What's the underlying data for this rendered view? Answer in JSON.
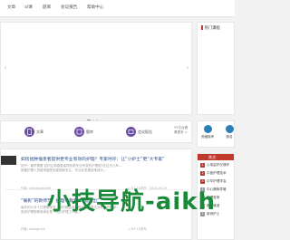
{
  "nav": {
    "items": [
      "文章",
      "al课",
      "题库",
      "会议报告",
      "帮助中心"
    ]
  },
  "side_card": {
    "title": "热门课程"
  },
  "quick_links": {
    "items": [
      {
        "label": "文章",
        "icon": "document-icon"
      },
      {
        "label": "题库",
        "icon": "question-icon"
      },
      {
        "label": "会议报告",
        "icon": "meeting-icon"
      }
    ],
    "more_label": "YY平台看\n看更多 >"
  },
  "side2": {
    "items": [
      {
        "label": "资格报考",
        "icon": "register-icon"
      },
      {
        "label": "报名",
        "icon": "signup-icon"
      }
    ]
  },
  "articles": [
    {
      "title": "如何给肿瘤患者提供更专业有效的护理？专家呼吁：让“小护士”更“大专家”",
      "summary_line1": "知乎：最早需要 如何让肿瘤患者得到更专业有效的护理呢?在过去几年...",
      "summary_line2": "肿瘤护理人员越来越受到重视和关注，专业化发展逐渐成为...",
      "author": "作者: chinadoctor66",
      "date": "◷ 07-14发布 · 2024-09-14"
    },
    {
      "title": "“联彰”的教师节：护理带教老师“圆满出”",
      "summary_line1": "每年的九月十日是教师节，我们都会用各种方式来表达对老师的感谢...",
      "summary_line2": "临床护理带教老师也是一线的护理工作者...",
      "author": "作者: zhongmeh",
      "date": "◷ 09-10发布"
    }
  ],
  "hot": {
    "title": "热文",
    "items": [
      {
        "num": "1",
        "text": "心电监护仪操作"
      },
      {
        "num": "2",
        "text": "中医护理技术"
      },
      {
        "num": "3",
        "text": "中华护理学会"
      },
      {
        "num": "4",
        "text": "中心静脉导管"
      },
      {
        "num": "5",
        "text": "护理查房"
      },
      {
        "num": "6",
        "text": "静脉输液"
      },
      {
        "num": "7",
        "text": "新冠护士"
      }
    ]
  },
  "watermark": {
    "text": "小技导航-aikh"
  }
}
